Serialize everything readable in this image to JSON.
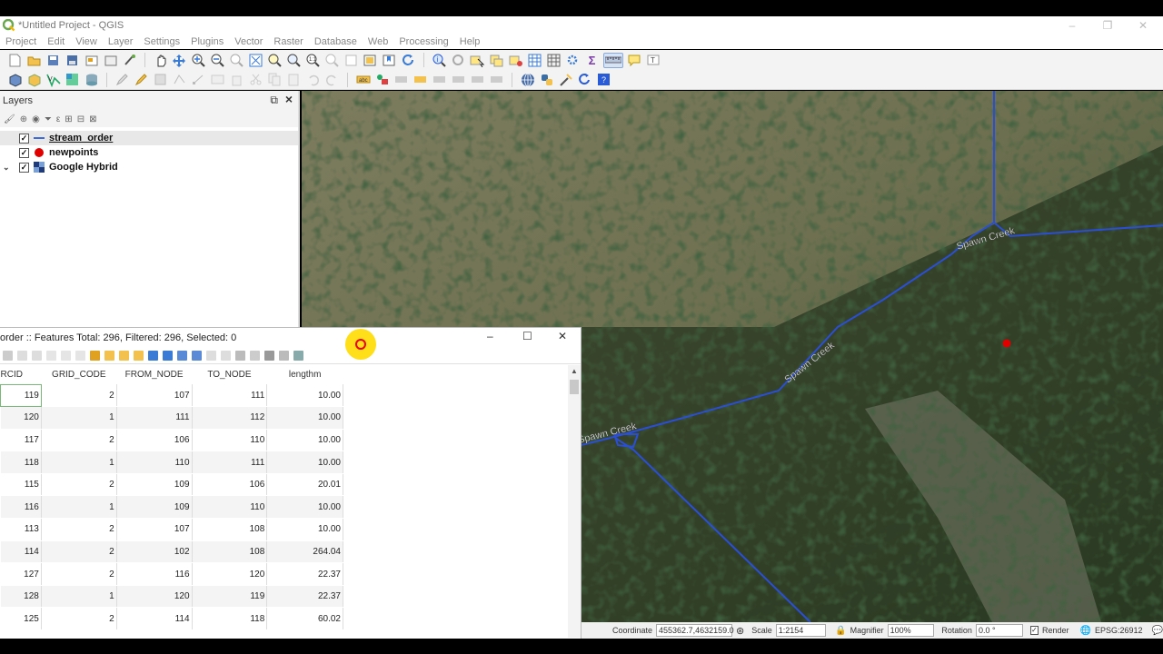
{
  "app": {
    "window_title": "*Untitled Project - QGIS",
    "window_controls": [
      "–",
      "❐",
      "✕"
    ]
  },
  "menu": [
    "Project",
    "Edit",
    "View",
    "Layer",
    "Settings",
    "Plugins",
    "Vector",
    "Raster",
    "Database",
    "Web",
    "Processing",
    "Help"
  ],
  "layers_panel": {
    "title": "Layers",
    "layers": [
      {
        "name": "stream_order",
        "checked": true,
        "symbol": "line-icon",
        "color": "#2a5bd7",
        "expandable": false,
        "selected": true
      },
      {
        "name": "newpoints",
        "checked": true,
        "symbol": "point-icon",
        "color": "#e00000",
        "expandable": false,
        "selected": false
      },
      {
        "name": "Google Hybrid",
        "checked": true,
        "symbol": "raster-icon",
        "color": "#1f3b7a",
        "expandable": true,
        "selected": false
      }
    ]
  },
  "map": {
    "labels": [
      "Spawn Creek",
      "Spawn Creek",
      "Spawn Creek"
    ],
    "stream_color": "#2a4fd6",
    "point_color": "#e00000"
  },
  "attribute_table": {
    "title": "order :: Features Total: 296, Filtered: 296, Selected: 0",
    "columns": [
      "RCID",
      "GRID_CODE",
      "FROM_NODE",
      "TO_NODE",
      "lengthm"
    ],
    "rows": [
      [
        "119",
        "2",
        "107",
        "111",
        "10.00"
      ],
      [
        "120",
        "1",
        "111",
        "112",
        "10.00"
      ],
      [
        "117",
        "2",
        "106",
        "110",
        "10.00"
      ],
      [
        "118",
        "1",
        "110",
        "111",
        "10.00"
      ],
      [
        "115",
        "2",
        "109",
        "106",
        "20.01"
      ],
      [
        "116",
        "1",
        "109",
        "110",
        "10.00"
      ],
      [
        "113",
        "2",
        "107",
        "108",
        "10.00"
      ],
      [
        "114",
        "2",
        "102",
        "108",
        "264.04"
      ],
      [
        "127",
        "2",
        "116",
        "120",
        "22.37"
      ],
      [
        "128",
        "1",
        "120",
        "119",
        "22.37"
      ],
      [
        "125",
        "2",
        "114",
        "118",
        "60.02"
      ]
    ]
  },
  "statusbar": {
    "coordinate_label": "Coordinate",
    "coordinate_value": "455362.7,4632159.0",
    "scale_label": "Scale",
    "scale_value": "1:2154",
    "magnifier_label": "Magnifier",
    "magnifier_value": "100%",
    "rotation_label": "Rotation",
    "rotation_value": "0.0 °",
    "render_label": "Render",
    "crs_label": "EPSG:26912"
  }
}
